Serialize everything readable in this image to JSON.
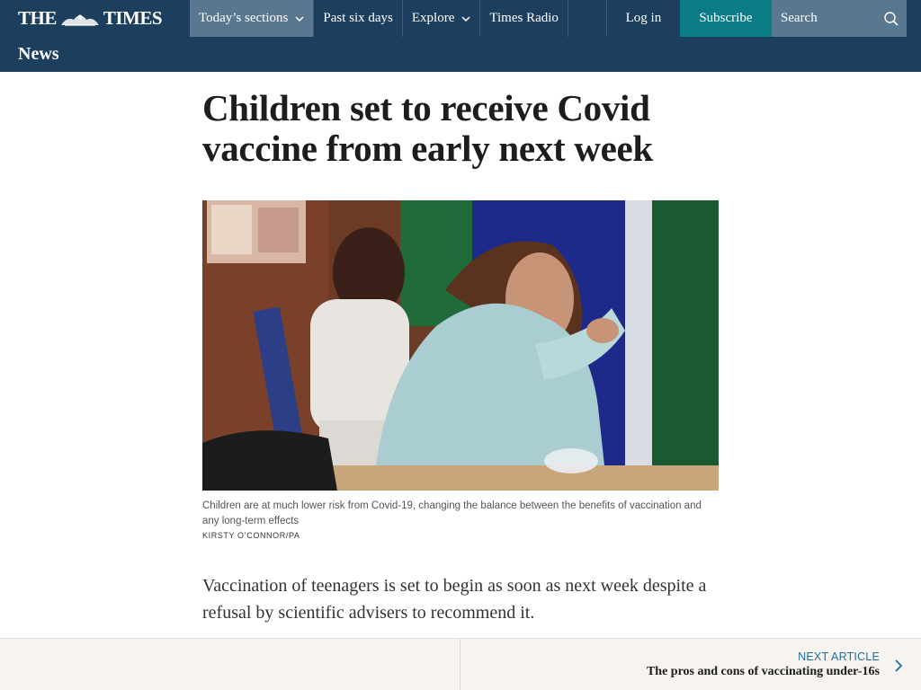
{
  "nav": {
    "logo_text_left": "THE",
    "logo_text_right": "TIMES",
    "items": [
      {
        "label": "Today’s sections",
        "has_dropdown": true,
        "active": true
      },
      {
        "label": "Past six days",
        "has_dropdown": false
      },
      {
        "label": "Explore",
        "has_dropdown": true
      },
      {
        "label": "Times Radio",
        "has_dropdown": false
      }
    ],
    "login_label": "Log in",
    "subscribe_label": "Subscribe",
    "search_placeholder": "Search",
    "search_icon": "search-icon"
  },
  "section": {
    "title": "News"
  },
  "article": {
    "headline": "Children set to receive Covid vaccine from early next week",
    "caption": "Children are at much lower risk from Covid-19, changing the balance between the benefits of vaccination and any long-term effects",
    "credit": "KIRSTY O’CONNOR/PA",
    "standfirst": "Vaccination of teenagers is set to begin as soon as next week despite a refusal by scientific advisers to recommend it."
  },
  "next_article": {
    "label": "NEXT ARTICLE",
    "title": "The pros and cons of vaccinating under-16s",
    "icon": "chevron-right-icon"
  },
  "colors": {
    "nav_bg": "#1d3f5e",
    "nav_active": "#5a7790",
    "subscribe": "#0b7b86",
    "footer_bg": "#f7f4f0",
    "link_blue": "#1f6da0"
  }
}
